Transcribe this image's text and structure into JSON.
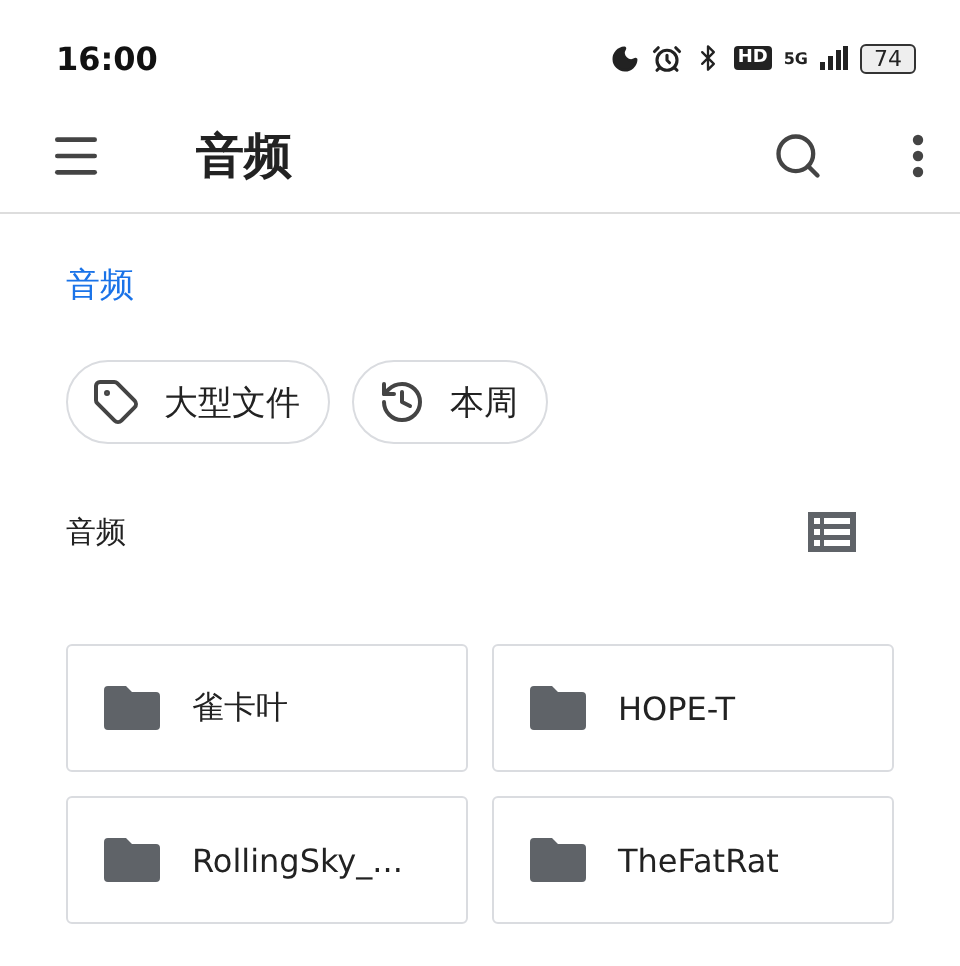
{
  "status_bar": {
    "time": "16:00",
    "hd": "HD",
    "network": "5G",
    "battery": "74"
  },
  "app_bar": {
    "title": "音频"
  },
  "breadcrumb": "音频",
  "chips": [
    {
      "kind": "tag",
      "label": "大型文件"
    },
    {
      "kind": "history",
      "label": "本周"
    }
  ],
  "section": {
    "title": "音频"
  },
  "folders": [
    {
      "name": "雀卡叶"
    },
    {
      "name": "HOPE-T"
    },
    {
      "name": "RollingSky_..."
    },
    {
      "name": "TheFatRat"
    }
  ]
}
